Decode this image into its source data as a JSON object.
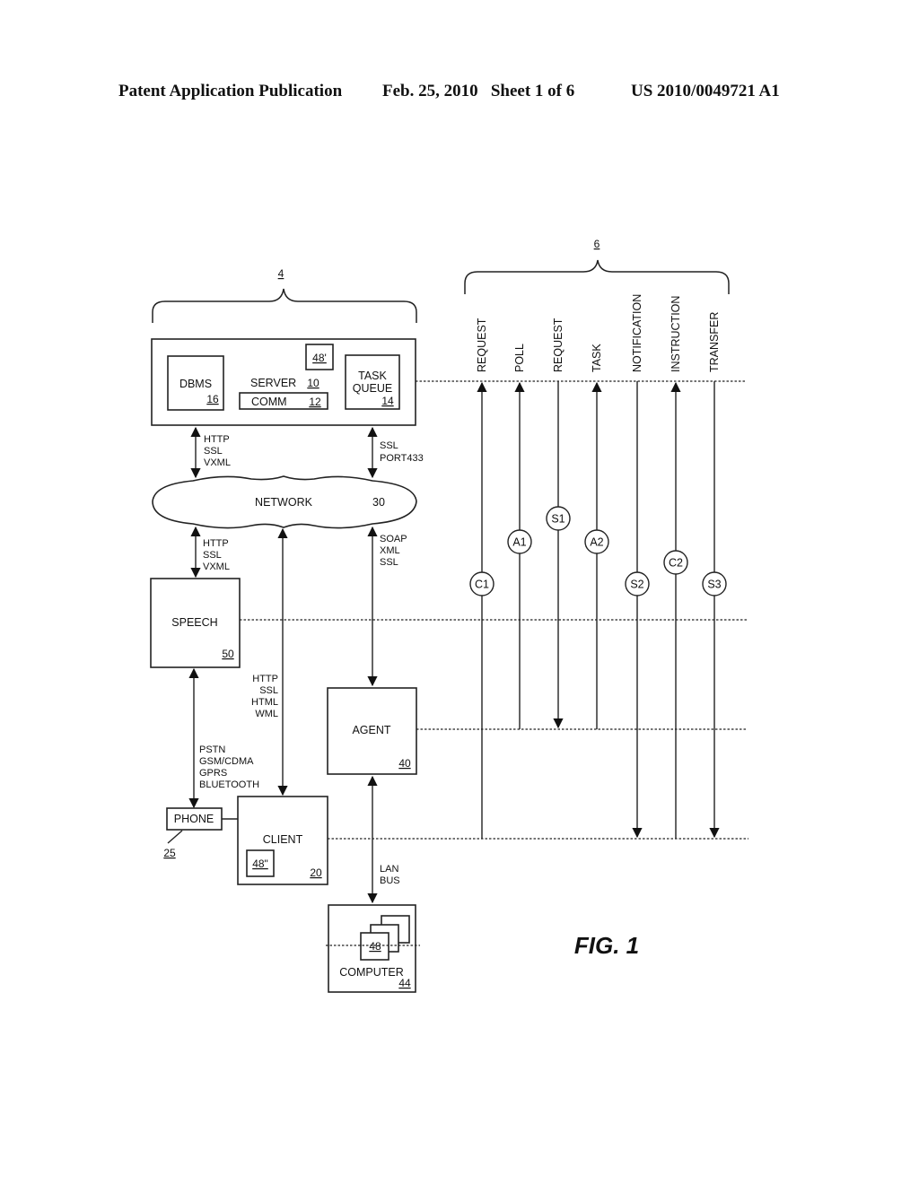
{
  "header": {
    "publication": "Patent Application Publication",
    "date_sheet": "Feb. 25, 2010   Sheet 1 of 6",
    "number": "US 2010/0049721 A1"
  },
  "figure_label": "FIG. 1",
  "braces": {
    "left_ref": "4",
    "right_ref": "6"
  },
  "server": {
    "label": "SERVER",
    "ref": "10",
    "comm_label": "COMM",
    "comm_ref": "12",
    "dbms_label": "DBMS",
    "dbms_ref": "16",
    "task_queue_line1": "TASK",
    "task_queue_line2": "QUEUE",
    "task_queue_ref": "14",
    "module_ref": "48'"
  },
  "network": {
    "label": "NETWORK",
    "ref": "30"
  },
  "speech": {
    "label": "SPEECH",
    "ref": "50"
  },
  "agent": {
    "label": "AGENT",
    "ref": "40"
  },
  "client": {
    "label": "CLIENT",
    "ref": "20",
    "module_ref": "48\""
  },
  "phone": {
    "label": "PHONE",
    "ref": "25"
  },
  "computer": {
    "label": "COMPUTER",
    "ref": "44",
    "module_ref": "48"
  },
  "protocols": {
    "server_network_left": [
      "HTTP",
      "SSL",
      "VXML"
    ],
    "server_network_right": [
      "SSL",
      "PORT433"
    ],
    "network_speech": [
      "HTTP",
      "SSL",
      "VXML"
    ],
    "network_agent": [
      "SOAP",
      "XML",
      "SSL"
    ],
    "network_client": [
      "HTTP",
      "SSL",
      "HTML",
      "WML"
    ],
    "speech_phone": [
      "PSTN",
      "GSM/CDMA",
      "GPRS",
      "BLUETOOTH"
    ],
    "agent_computer": [
      "LAN",
      "BUS"
    ]
  },
  "messages": {
    "columns": [
      "REQUEST",
      "POLL",
      "REQUEST",
      "TASK",
      "NOTIFICATION",
      "INSTRUCTION",
      "TRANSFER"
    ],
    "markers": [
      "C1",
      "A1",
      "S1",
      "A2",
      "S2",
      "C2",
      "S3"
    ]
  }
}
